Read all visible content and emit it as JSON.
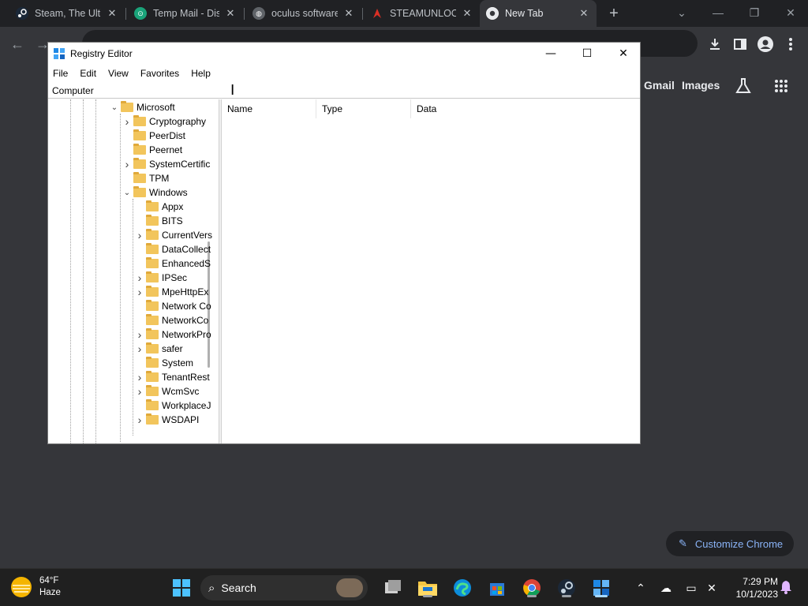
{
  "browser": {
    "tabs": [
      {
        "title": "Steam, The Ultimate",
        "icon": "steam-favicon",
        "active": false
      },
      {
        "title": "Temp Mail - Disposable",
        "icon": "tempmail-favicon",
        "active": false
      },
      {
        "title": "oculus software",
        "icon": "globe-favicon",
        "active": false
      },
      {
        "title": "STEAMUNLOCKED",
        "icon": "steamunlocked-favicon",
        "active": false
      },
      {
        "title": "New Tab",
        "icon": "chrome-favicon",
        "active": true
      }
    ],
    "new_tab_symbol": "+",
    "links": {
      "gmail": "Gmail",
      "images": "Images"
    },
    "customize_label": "Customize Chrome"
  },
  "regedit": {
    "title": "Registry Editor",
    "menu": [
      "File",
      "Edit",
      "View",
      "Favorites",
      "Help"
    ],
    "address": "Computer",
    "tree": [
      {
        "label": "Microsoft",
        "level": 0,
        "expander": "expanded"
      },
      {
        "label": "Cryptography",
        "level": 1,
        "expander": "collapsed"
      },
      {
        "label": "PeerDist",
        "level": 1,
        "expander": "none"
      },
      {
        "label": "Peernet",
        "level": 1,
        "expander": "none"
      },
      {
        "label": "SystemCertific",
        "level": 1,
        "expander": "collapsed"
      },
      {
        "label": "TPM",
        "level": 1,
        "expander": "none"
      },
      {
        "label": "Windows",
        "level": 1,
        "expander": "expanded"
      },
      {
        "label": "Appx",
        "level": 2,
        "expander": "none"
      },
      {
        "label": "BITS",
        "level": 2,
        "expander": "none"
      },
      {
        "label": "CurrentVers",
        "level": 2,
        "expander": "collapsed"
      },
      {
        "label": "DataCollect",
        "level": 2,
        "expander": "none"
      },
      {
        "label": "EnhancedS",
        "level": 2,
        "expander": "none"
      },
      {
        "label": "IPSec",
        "level": 2,
        "expander": "collapsed"
      },
      {
        "label": "MpeHttpEx",
        "level": 2,
        "expander": "collapsed"
      },
      {
        "label": "Network Co",
        "level": 2,
        "expander": "none"
      },
      {
        "label": "NetworkCo",
        "level": 2,
        "expander": "none"
      },
      {
        "label": "NetworkPro",
        "level": 2,
        "expander": "collapsed"
      },
      {
        "label": "safer",
        "level": 2,
        "expander": "collapsed"
      },
      {
        "label": "System",
        "level": 2,
        "expander": "none"
      },
      {
        "label": "TenantRest",
        "level": 2,
        "expander": "collapsed"
      },
      {
        "label": "WcmSvc",
        "level": 2,
        "expander": "collapsed"
      },
      {
        "label": "WorkplaceJ",
        "level": 2,
        "expander": "none"
      },
      {
        "label": "WSDAPI",
        "level": 2,
        "expander": "collapsed"
      }
    ],
    "columns": [
      "Name",
      "Type",
      "Data"
    ]
  },
  "taskbar": {
    "weather": {
      "temp": "64°F",
      "condition": "Haze"
    },
    "search_label": "Search",
    "apps": [
      "start-icon",
      "search-icon",
      "task-view-icon",
      "file-explorer-icon",
      "edge-icon",
      "store-icon",
      "chrome-icon",
      "steam-icon",
      "regedit-icon"
    ],
    "time": "7:29 PM",
    "date": "10/1/2023"
  },
  "colors": {
    "chrome_dark": "#202124",
    "chrome_bg": "#35363a",
    "taskbar": "#202020",
    "folder": "#f2c55c",
    "accent_blue": "#8ab4f8"
  }
}
